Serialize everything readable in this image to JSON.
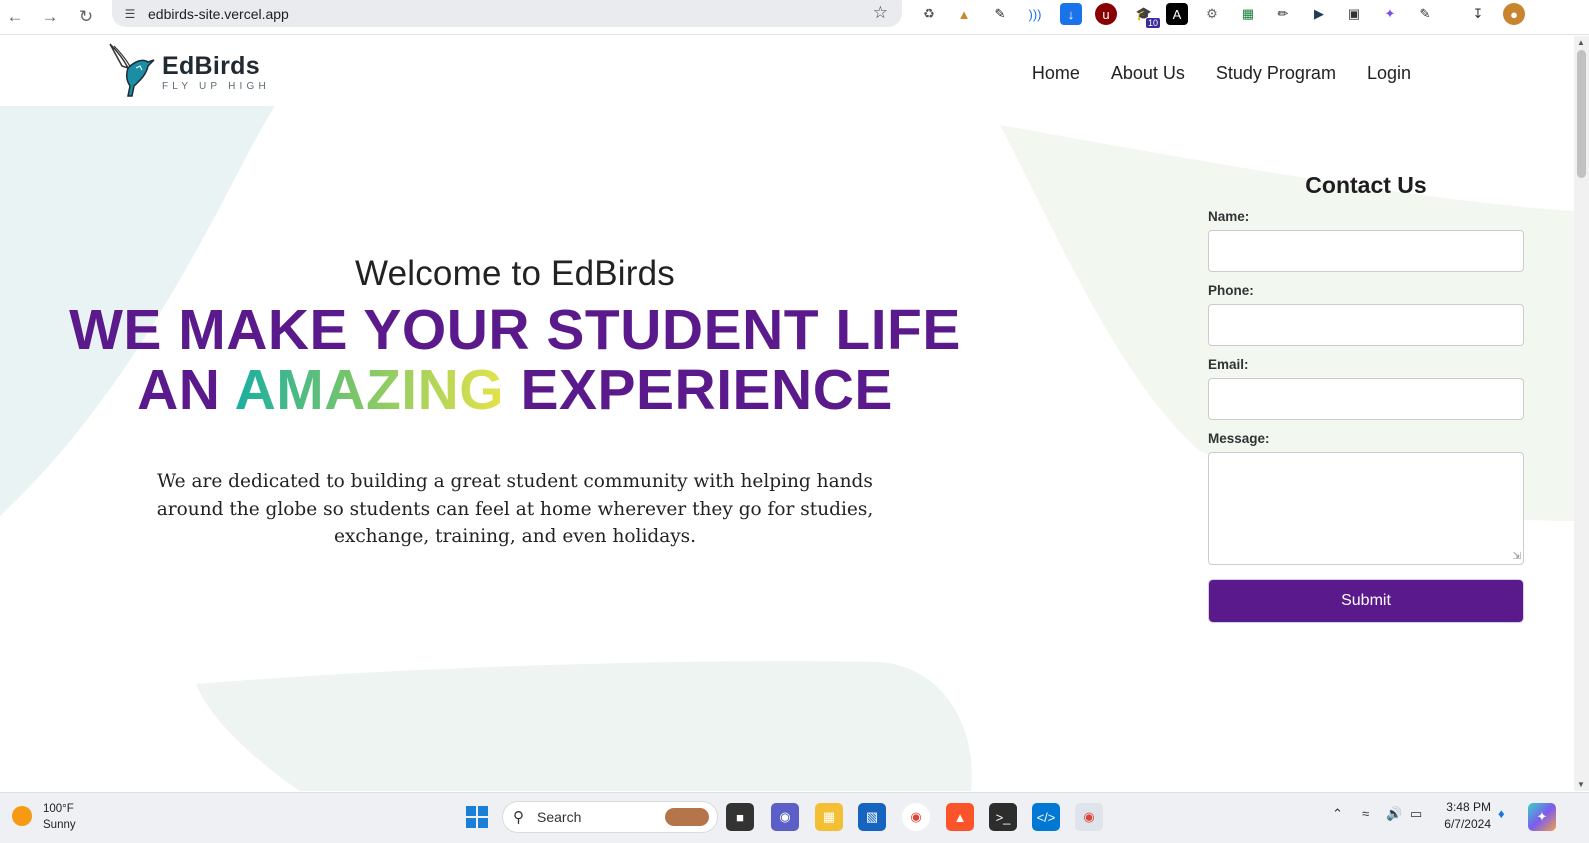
{
  "browser": {
    "url": "edbirds-site.vercel.app",
    "extensions": [
      "recycle-icon",
      "spartan-helmet-icon",
      "eyedropper-icon",
      "wifi-signal-icon",
      "download-arrow-icon",
      "ublock-icon",
      "graduation-cap-icon",
      "square-a-icon",
      "gear-icon",
      "calendar-icon",
      "pen-icon",
      "video-icon",
      "screenshot-icon",
      "sparkle-icon",
      "puzzle-icon"
    ],
    "ext_badge": "10"
  },
  "site": {
    "logo": {
      "name": "EdBirds",
      "tagline": "FLY UP HIGH"
    },
    "nav": [
      "Home",
      "About Us",
      "Study Program",
      "Login"
    ]
  },
  "hero": {
    "welcome": "Welcome to EdBirds",
    "headline_line1": "WE MAKE YOUR STUDENT LIFE",
    "headline_an": "AN",
    "headline_amazing": "AMAZING",
    "headline_experience": "EXPERIENCE",
    "description": "We are dedicated to building a great student community with helping hands around the globe so students can feel at home wherever they go for studies, exchange, training, and even holidays."
  },
  "contact": {
    "title": "Contact Us",
    "name_label": "Name:",
    "phone_label": "Phone:",
    "email_label": "Email:",
    "message_label": "Message:",
    "submit_label": "Submit"
  },
  "taskbar": {
    "weather_temp": "100°F",
    "weather_desc": "Sunny",
    "search_label": "Search",
    "time": "3:48 PM",
    "date": "6/7/2024"
  },
  "colors": {
    "brand_purple": "#5b1a8b",
    "gradient": [
      "#1aaea2",
      "#7cc66a",
      "#e5e24a"
    ]
  }
}
